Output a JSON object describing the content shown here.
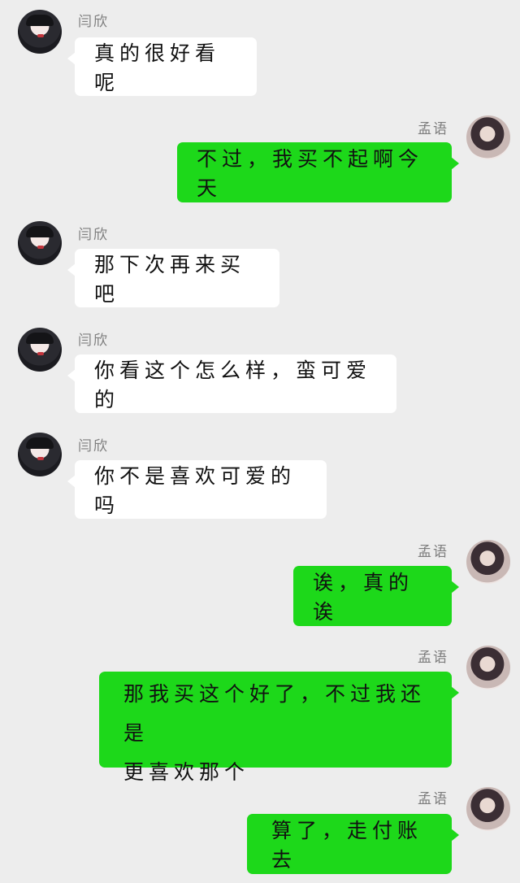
{
  "participants": {
    "left_name": "闫欣",
    "right_name": "孟语"
  },
  "messages": [
    {
      "side": "left",
      "sender": "闫欣",
      "text": "真的很好看呢"
    },
    {
      "side": "right",
      "sender": "孟语",
      "text": "不过，我买不起啊今天"
    },
    {
      "side": "left",
      "sender": "闫欣",
      "text": "那下次再来买吧"
    },
    {
      "side": "left",
      "sender": "闫欣",
      "text": "你看这个怎么样，蛮可爱的"
    },
    {
      "side": "left",
      "sender": "闫欣",
      "text": "你不是喜欢可爱的吗"
    },
    {
      "side": "right",
      "sender": "孟语",
      "text": "诶，真的诶"
    },
    {
      "side": "right",
      "sender": "孟语",
      "text": "那我买这个好了，不过我还是\n更喜欢那个"
    },
    {
      "side": "right",
      "sender": "孟语",
      "text": "算了，走付账去"
    }
  ],
  "colors": {
    "background": "#ededed",
    "incoming_bubble": "#ffffff",
    "outgoing_bubble": "#1dd81a",
    "name_text": "#7d7d7d"
  },
  "icons": {
    "left_avatar": "avatar-girl-dark-hair",
    "right_avatar": "avatar-girl-light-background"
  }
}
